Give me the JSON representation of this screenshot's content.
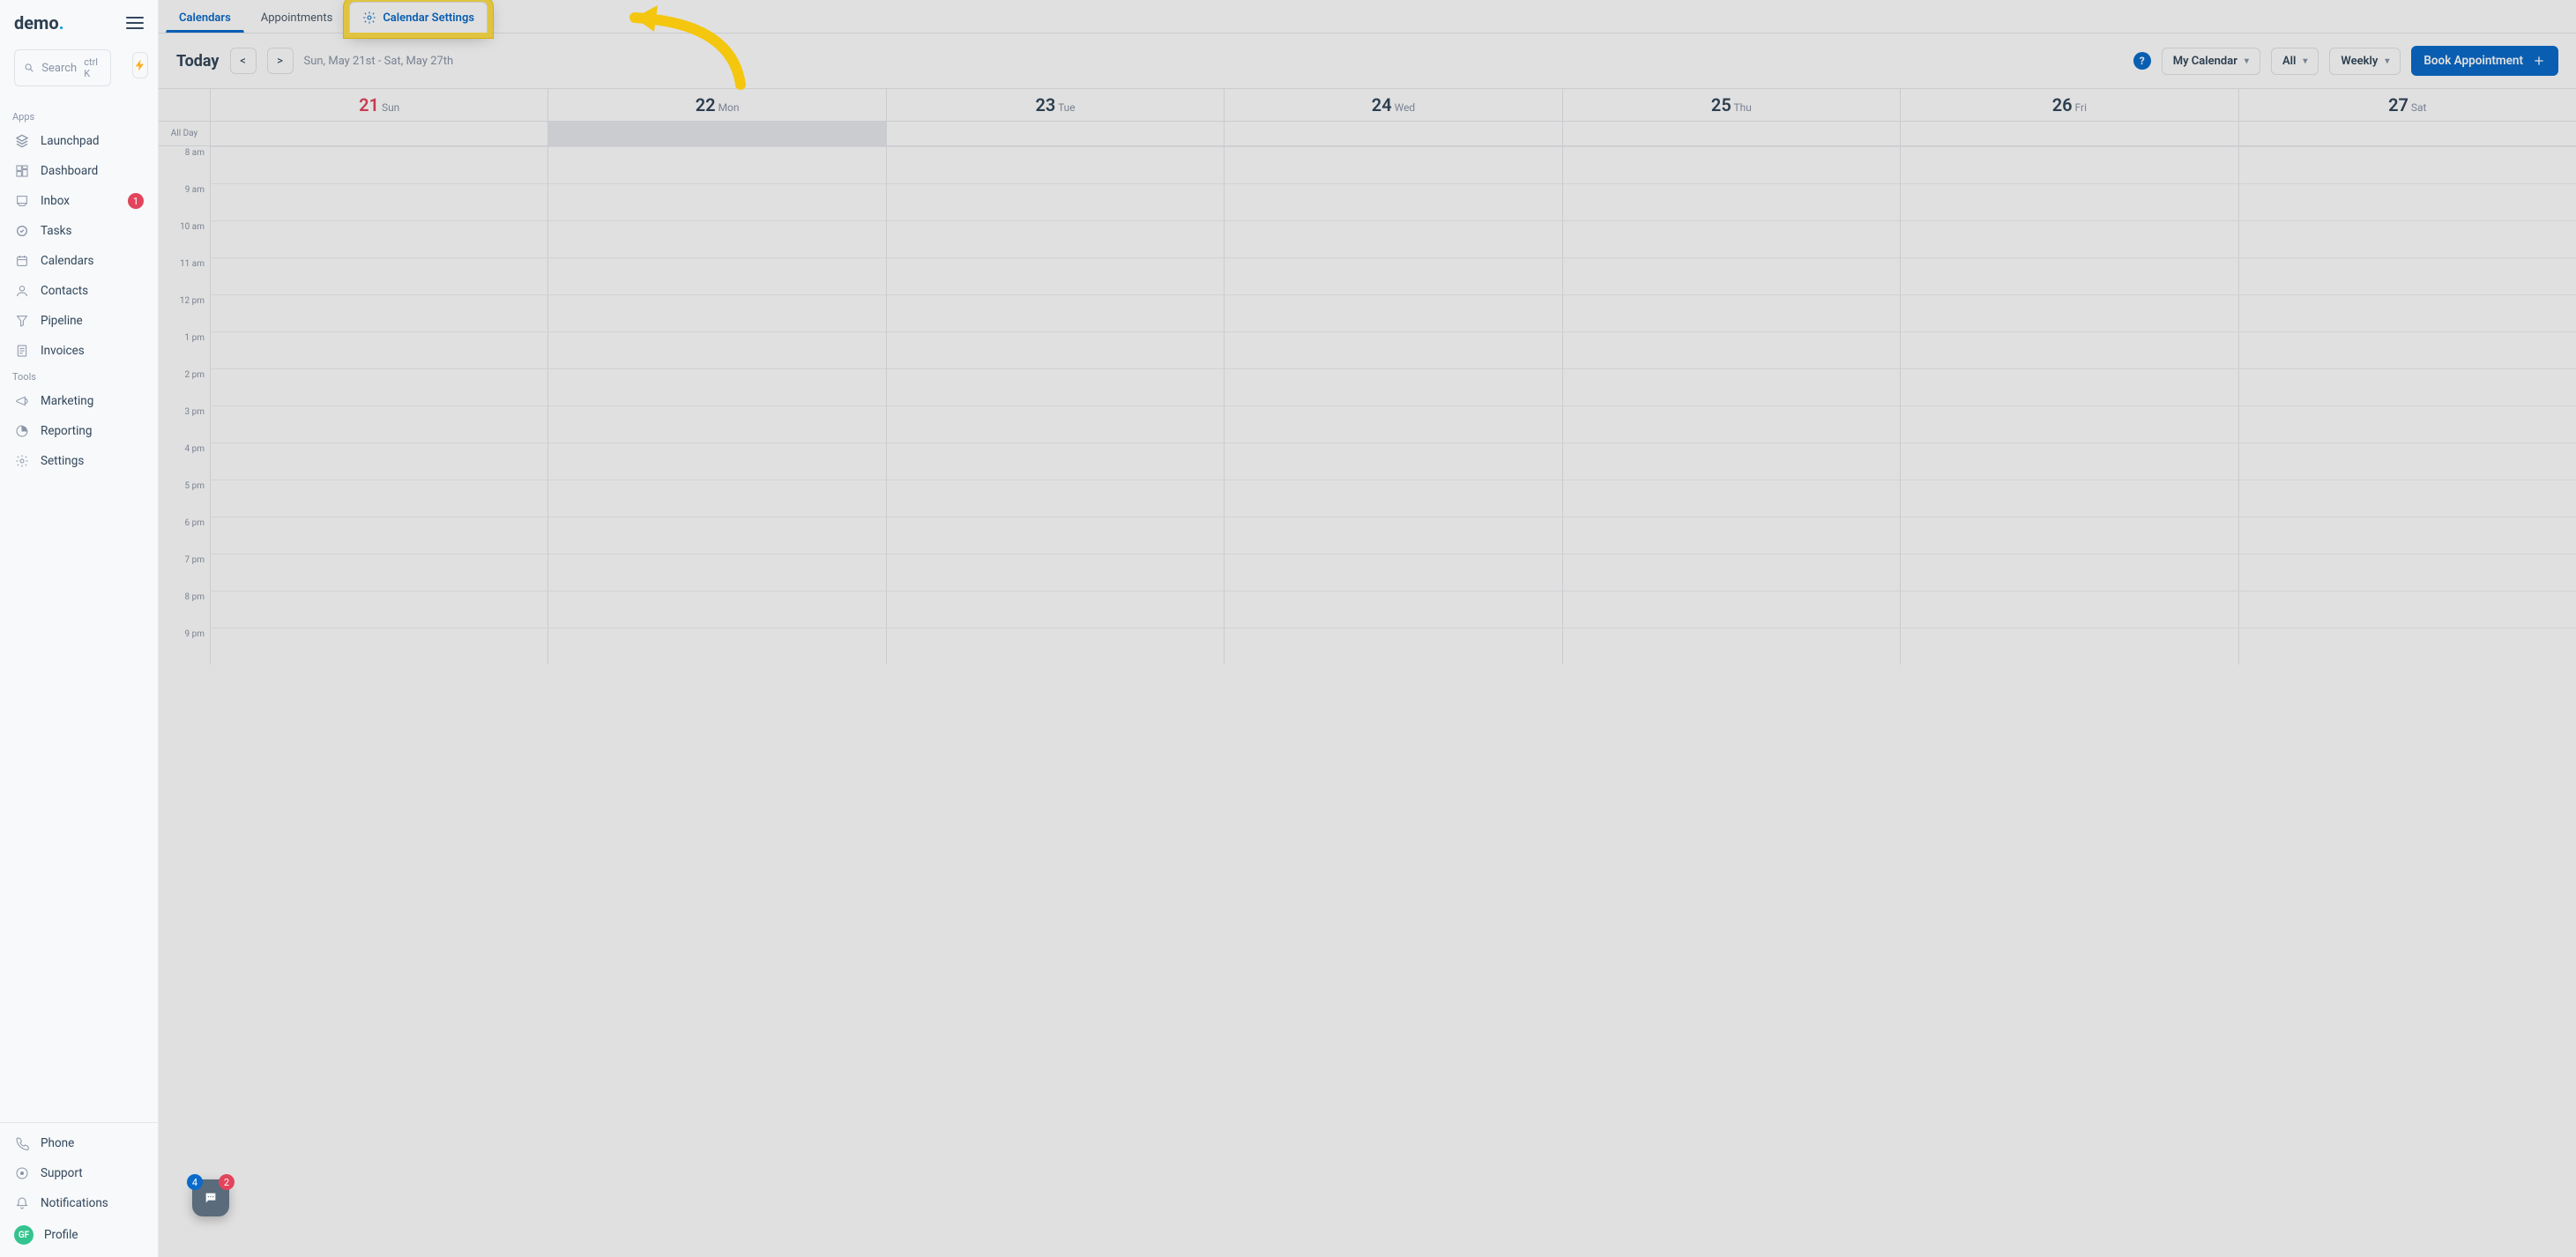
{
  "brand": {
    "name": "demo",
    "dot": "."
  },
  "search": {
    "placeholder": "Search",
    "shortcut": "ctrl K"
  },
  "sidebar": {
    "sections": [
      {
        "label": "Apps",
        "items": [
          {
            "icon": "launchpad",
            "label": "Launchpad"
          },
          {
            "icon": "dashboard",
            "label": "Dashboard"
          },
          {
            "icon": "inbox",
            "label": "Inbox",
            "badge": "1"
          },
          {
            "icon": "tasks",
            "label": "Tasks"
          },
          {
            "icon": "calendars",
            "label": "Calendars"
          },
          {
            "icon": "contacts",
            "label": "Contacts"
          },
          {
            "icon": "pipeline",
            "label": "Pipeline"
          },
          {
            "icon": "invoices",
            "label": "Invoices"
          }
        ]
      },
      {
        "label": "Tools",
        "items": [
          {
            "icon": "marketing",
            "label": "Marketing"
          },
          {
            "icon": "reporting",
            "label": "Reporting"
          },
          {
            "icon": "settings",
            "label": "Settings"
          }
        ]
      }
    ],
    "bottom": [
      {
        "icon": "phone",
        "label": "Phone"
      },
      {
        "icon": "support",
        "label": "Support"
      },
      {
        "icon": "notifications",
        "label": "Notifications"
      },
      {
        "icon": "profile",
        "label": "Profile",
        "avatar": "GF"
      }
    ]
  },
  "tabs": [
    {
      "id": "calendars",
      "label": "Calendars",
      "active": true
    },
    {
      "id": "appointments",
      "label": "Appointments"
    },
    {
      "id": "settings",
      "label": "Calendar Settings",
      "icon": "gear",
      "highlight": true
    }
  ],
  "toolbar": {
    "today": "Today",
    "prev": "<",
    "next": ">",
    "range": "Sun, May 21st - Sat, May 27th",
    "my_calendar": "My Calendar",
    "filter": "All",
    "view": "Weekly",
    "book": "Book Appointment"
  },
  "calendar": {
    "days": [
      {
        "num": "21",
        "dow": "Sun",
        "class": "sun"
      },
      {
        "num": "22",
        "dow": "Mon",
        "class": "mon"
      },
      {
        "num": "23",
        "dow": "Tue"
      },
      {
        "num": "24",
        "dow": "Wed"
      },
      {
        "num": "25",
        "dow": "Thu"
      },
      {
        "num": "26",
        "dow": "Fri"
      },
      {
        "num": "27",
        "dow": "Sat"
      }
    ],
    "all_day_label": "All Day",
    "hours": [
      "8 am",
      "9 am",
      "10 am",
      "11 am",
      "12 pm",
      "1 pm",
      "2 pm",
      "3 pm",
      "4 pm",
      "5 pm",
      "6 pm",
      "7 pm",
      "8 pm",
      "9 pm"
    ]
  },
  "chat": {
    "count_red": "2",
    "count_blue": "4"
  }
}
